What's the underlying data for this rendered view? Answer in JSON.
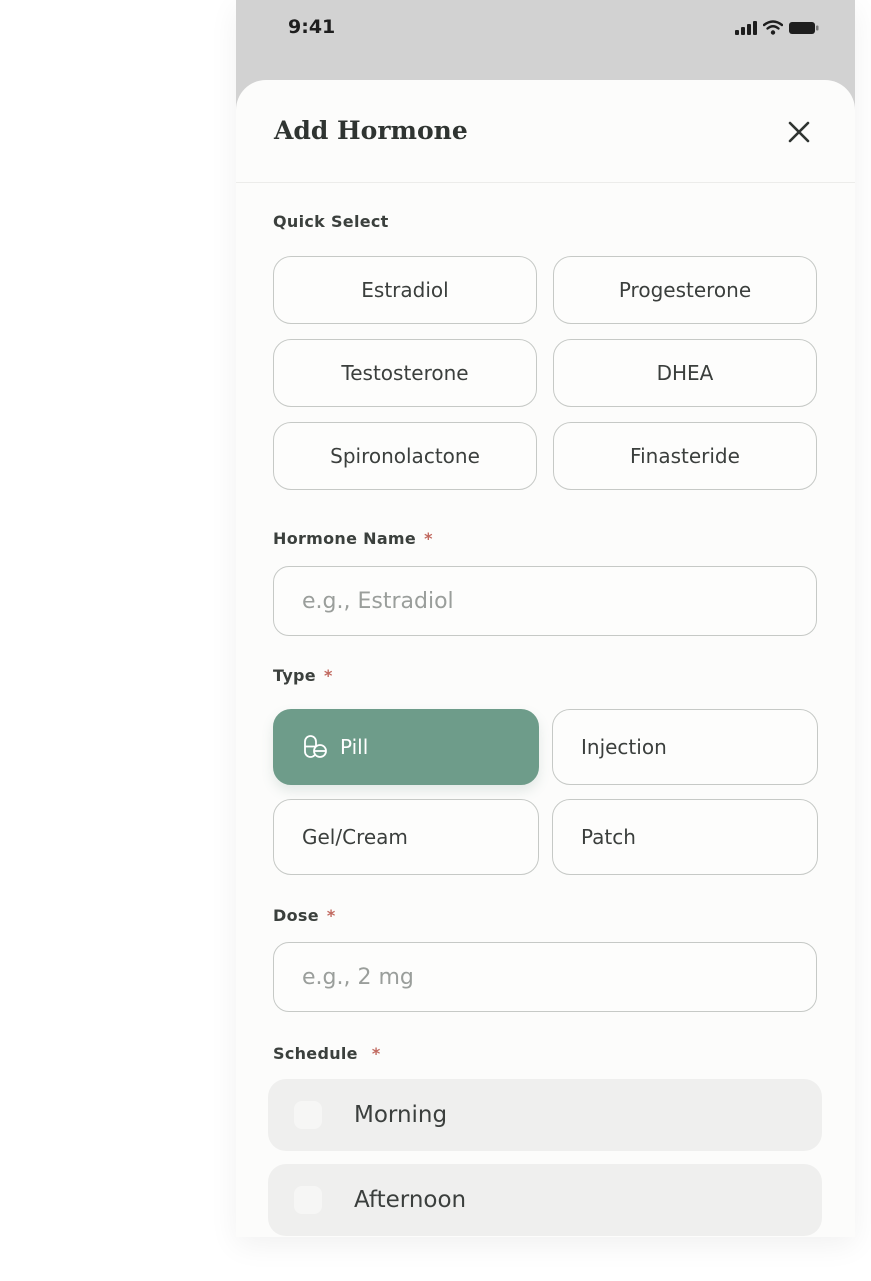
{
  "status_bar": {
    "time": "9:41"
  },
  "sheet": {
    "title": "Add Hormone",
    "close_icon": "close-icon"
  },
  "quick_select": {
    "label": "Quick Select",
    "options": [
      "Estradiol",
      "Progesterone",
      "Testosterone",
      "DHEA",
      "Spironolactone",
      "Finasteride"
    ]
  },
  "hormone_name": {
    "label": "Hormone Name",
    "required_mark": "*",
    "placeholder": "e.g., Estradiol",
    "value": ""
  },
  "type": {
    "label": "Type",
    "required_mark": "*",
    "options": [
      "Pill",
      "Injection",
      "Gel/Cream",
      "Patch"
    ],
    "selected": "Pill",
    "selected_icon": "pill-icon"
  },
  "dose": {
    "label": "Dose",
    "required_mark": "*",
    "placeholder": "e.g., 2 mg",
    "value": ""
  },
  "schedule": {
    "label": "Schedule",
    "required_mark": "*",
    "options": [
      "Morning",
      "Afternoon"
    ]
  },
  "colors": {
    "accent": "#6e9c8a",
    "required": "#c0685e",
    "border": "#c6c9c6"
  }
}
